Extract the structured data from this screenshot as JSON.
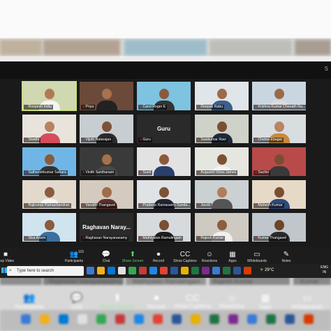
{
  "participants": [
    {
      "name": "Roopesh India",
      "bg": "#cfd8b0",
      "skin": "#b07a55",
      "shirt": "#f4f4f4",
      "active": true
    },
    {
      "name": "Priya",
      "bg": "#6b4a3a",
      "skin": "#a8724f",
      "shirt": "#222"
    },
    {
      "name": "Carol Roger E",
      "bg": "#7ec3e0",
      "skin": "#8a5a3c",
      "shirt": "#333"
    },
    {
      "name": "Deepak Rabu",
      "bg": "#dfe5e8",
      "skin": "#9c6b48",
      "shirt": "#3a5f8a"
    },
    {
      "name": "Krishna Kumar Chenath Ra...",
      "bg": "#c9d6e2",
      "skin": "#9a6a48",
      "shirt": "#dcdcdc"
    },
    {
      "name": "Swathi",
      "bg": "#e8e4dc",
      "skin": "#b98260",
      "shirt": "#d44d5c"
    },
    {
      "name": "Vijoth Natarajan",
      "bg": "#c8cdd2",
      "skin": "#7d5238",
      "shirt": "#2a2a2a"
    },
    {
      "name": "Guru",
      "bg": "#2a2a2a",
      "text_tile": true
    },
    {
      "name": "Sasikumar Ravi",
      "bg": "#cfd2c8",
      "skin": "#7a4f33",
      "shirt": "#1f2a3a"
    },
    {
      "name": "Chetna Ebagat",
      "bg": "#d8dde0",
      "skin": "#b8855f",
      "shirt": "#c98a3a"
    },
    {
      "name": "Satheeshkumar Sahara",
      "bg": "#6fb6e6",
      "skin": "#8a5a3a",
      "shirt": "#333"
    },
    {
      "name": "Vinith Santhanam",
      "bg": "#3a3a3a",
      "skin": "#a6704c",
      "shirt": "#4a4a4a"
    },
    {
      "name": "Sunil",
      "bg": "#e2e2e2",
      "skin": "#8b5a3c",
      "shirt": "#2b3f6c"
    },
    {
      "name": "Augustin Vives James",
      "bg": "#e6e6e0",
      "skin": "#7c5235",
      "shirt": "#f2f2f2"
    },
    {
      "name": "Sachin",
      "bg": "#b94a4a",
      "skin": "#7a4d31",
      "shirt": "#3a3a3a"
    },
    {
      "name": "Rajkumar Ramachandran",
      "bg": "#e2d9cc",
      "skin": "#8a5c3d",
      "shirt": "#f5f5f5"
    },
    {
      "name": "Vanathi Thangavel",
      "bg": "#d4cabf",
      "skin": "#a06c4a",
      "shirt": "#5a2f2f"
    },
    {
      "name": "Pradeep Ramasamy Sunda...",
      "bg": "#dfe3e6",
      "skin": "#7e5236",
      "shirt": "#223"
    },
    {
      "name": "Jacob",
      "bg": "#cbd0d3",
      "skin": "#b07d58",
      "shirt": "#555"
    },
    {
      "name": "Mahesh Kumar",
      "bg": "#e6d9c6",
      "skin": "#7b4e31",
      "shirt": "#2d4a7a"
    },
    {
      "name": "Siva Aswin",
      "bg": "#cfe4ef",
      "skin": "#8c5c3b",
      "shirt": "#3b6f9e"
    },
    {
      "name": "Raghavan Narayanasamy",
      "bg": "#2a2a2a",
      "text_tile": true,
      "big_label": "Raghavan Naray..."
    },
    {
      "name": "Mathiyalan Ramalingam",
      "bg": "#d7dadd",
      "skin": "#7a4f34",
      "shirt": "#1d1d1d"
    },
    {
      "name": "Rajesh Kumar",
      "bg": "#cfcac1",
      "skin": "#8d5e3d",
      "shirt": "#f0f0f0"
    },
    {
      "name": "Kumar Thangavel",
      "bg": "#bfc7cc",
      "skin": "#6e4529",
      "shirt": "#2b2b2b"
    }
  ],
  "toolbar": [
    {
      "id": "stop-video",
      "label": "Stop Video",
      "icon": "■"
    },
    {
      "id": "participants",
      "label": "Participants",
      "icon": "👥",
      "badge": "101"
    },
    {
      "id": "chat",
      "label": "Chat",
      "icon": "💬"
    },
    {
      "id": "share-screen",
      "label": "Share Screen",
      "icon": "⬆",
      "green": true
    },
    {
      "id": "record",
      "label": "Record",
      "icon": "⏺"
    },
    {
      "id": "show-captions",
      "label": "Show Captions",
      "icon": "CC"
    },
    {
      "id": "reactions",
      "label": "Reactions",
      "icon": "☺"
    },
    {
      "id": "apps",
      "label": "Apps",
      "icon": "▦"
    },
    {
      "id": "whiteboards",
      "label": "Whiteboards",
      "icon": "▭"
    },
    {
      "id": "notes",
      "label": "Notes",
      "icon": "✎"
    }
  ],
  "taskbar": {
    "search_placeholder": "Type here to search",
    "weather": "29°C",
    "lang_line1": "ENG",
    "lang_line2": "IN"
  },
  "reflection": {
    "names": [
      "Raghavan Narayanasamy",
      "Mathiyalan Ramalingam",
      "Rajesh Kumar",
      "Kumar"
    ],
    "items": [
      "Participants",
      "Chat",
      "Share Screen",
      "Record",
      "Show Captions",
      "Reactions",
      "Apps",
      "Whiteboards"
    ]
  }
}
